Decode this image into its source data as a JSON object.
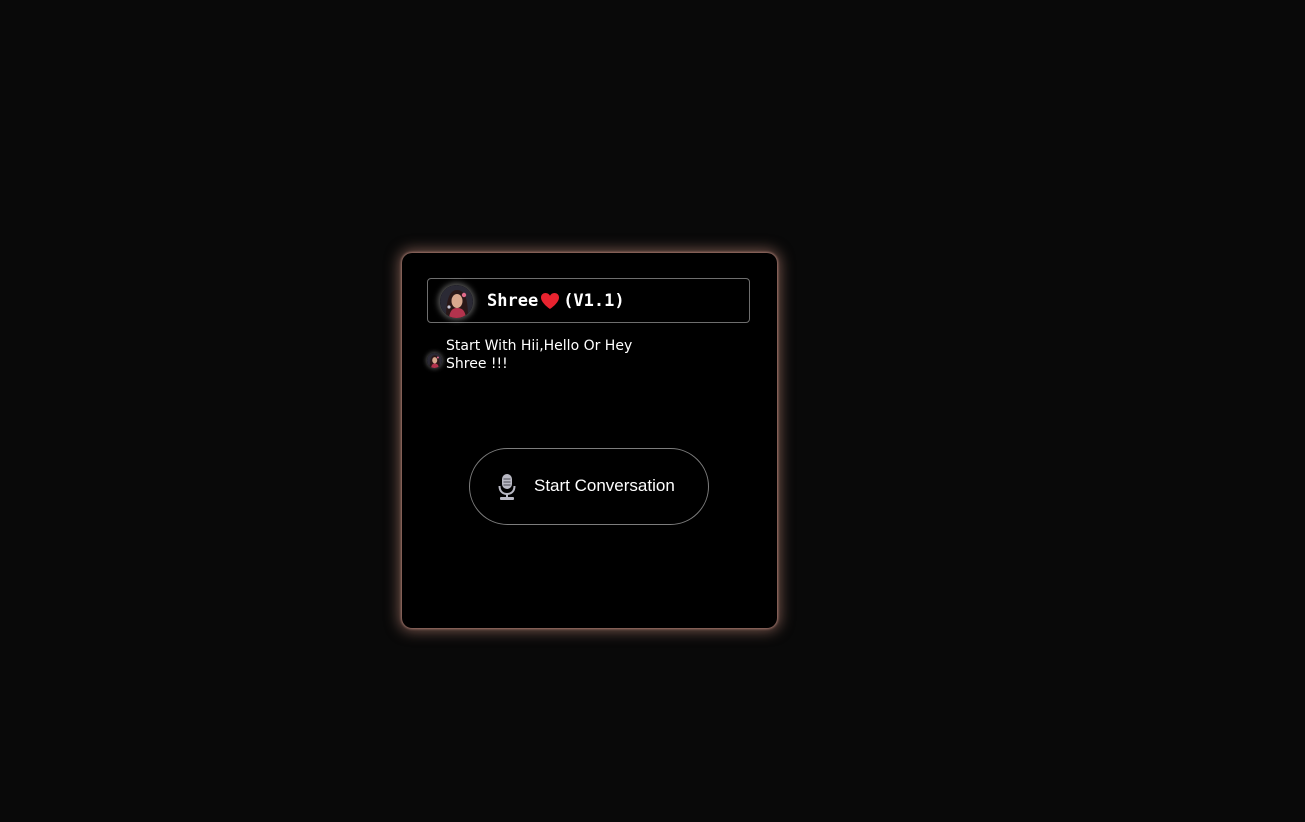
{
  "header": {
    "name": "Shree",
    "heart_icon": "red-heart-icon",
    "version": "(V1.1)"
  },
  "message": {
    "text": "Start With Hii,Hello Or Hey Shree !!!"
  },
  "button": {
    "label": "Start Conversation",
    "icon": "microphone-icon"
  },
  "colors": {
    "page_background": "#090909",
    "card_background": "#000000",
    "card_glow": "#cd9182",
    "heart": "#e8232f",
    "text": "#ffffff"
  }
}
